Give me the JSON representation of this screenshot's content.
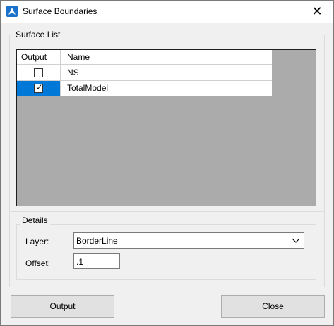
{
  "window": {
    "title": "Surface Boundaries"
  },
  "surface_list": {
    "group_label": "Surface List",
    "columns": [
      "Output",
      "Name"
    ],
    "rows": [
      {
        "name": "NS",
        "output": false,
        "selected": false
      },
      {
        "name": "TotalModel",
        "output": true,
        "selected": true
      }
    ]
  },
  "details": {
    "group_label": "Details",
    "layer_label": "Layer:",
    "layer_value": "BorderLine",
    "offset_label": "Offset:",
    "offset_value": ".1"
  },
  "buttons": {
    "output": "Output",
    "close": "Close"
  },
  "colors": {
    "selection": "#0078d7",
    "grid_background": "#ababab"
  }
}
